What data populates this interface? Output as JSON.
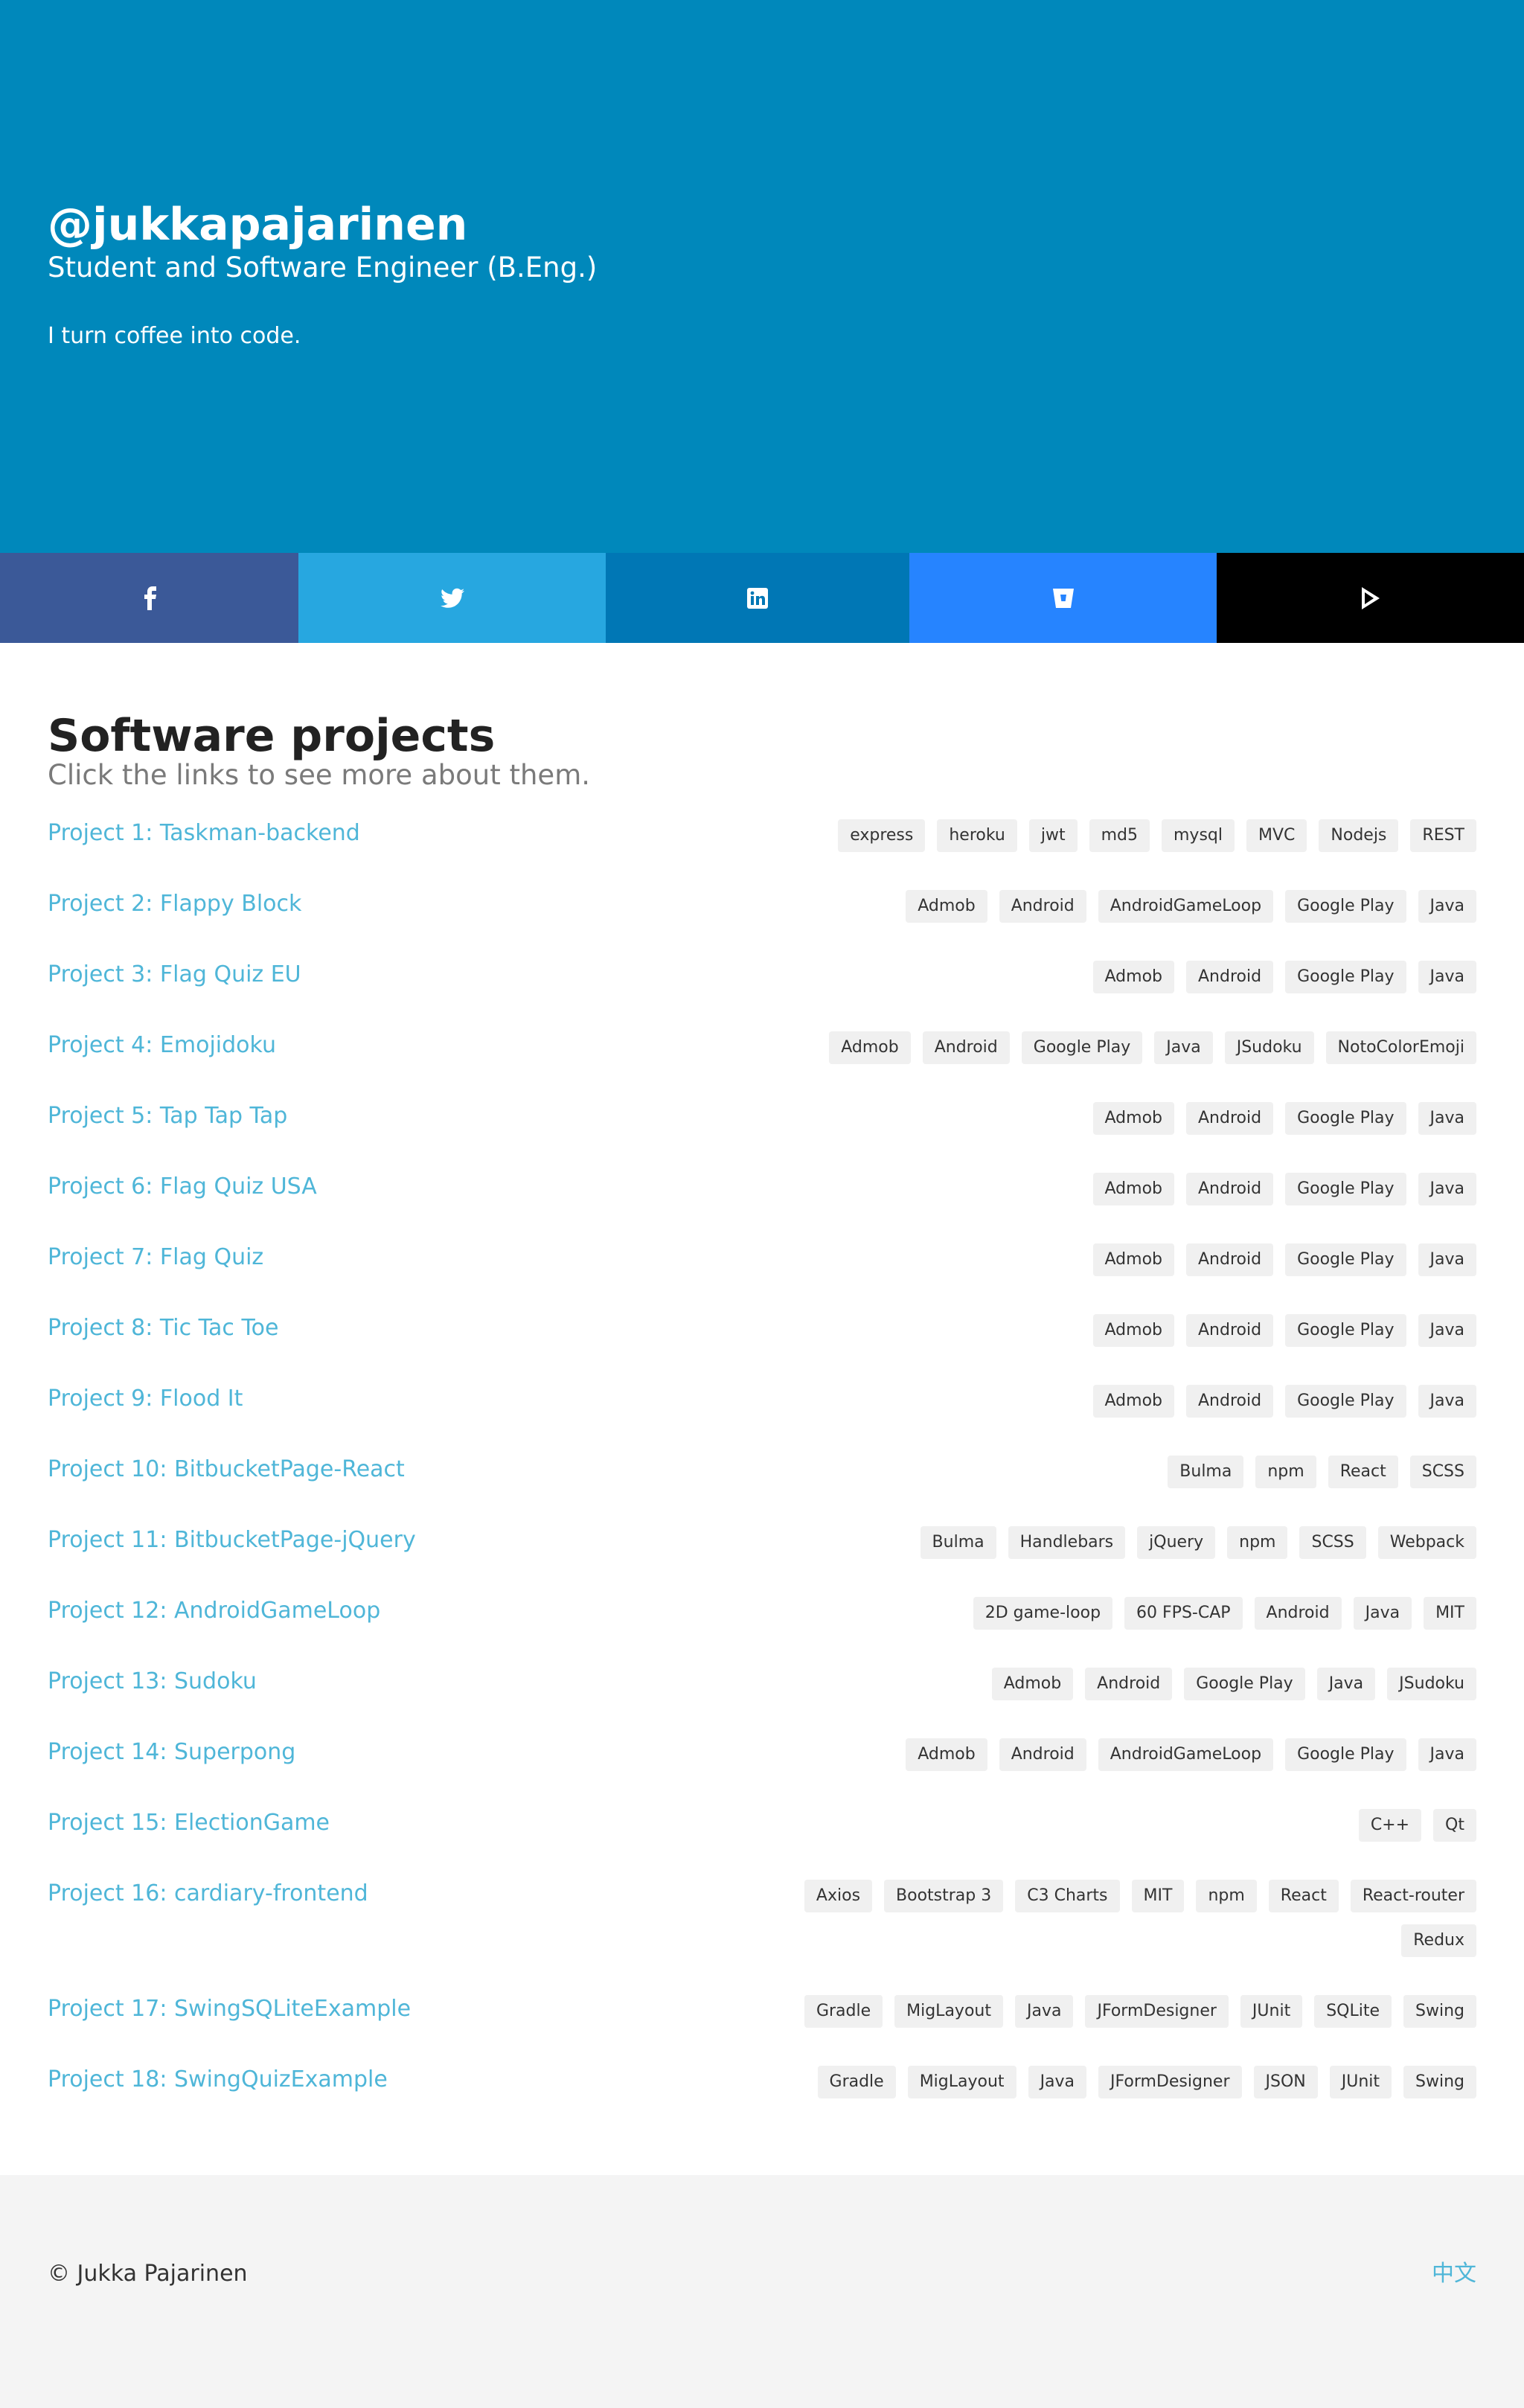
{
  "hero": {
    "title": "@jukkapajarinen",
    "subtitle": "Student and Software Engineer (B.Eng.)",
    "tagline": "I turn coffee into code."
  },
  "social": [
    {
      "name": "facebook",
      "icon": "facebook-icon",
      "color": "#3b5998"
    },
    {
      "name": "twitter",
      "icon": "twitter-icon",
      "color": "#27a7e0"
    },
    {
      "name": "linkedin",
      "icon": "linkedin-icon",
      "color": "#0077b5"
    },
    {
      "name": "bitbucket",
      "icon": "bitbucket-icon",
      "color": "#2684ff"
    },
    {
      "name": "google-play",
      "icon": "google-play-icon",
      "color": "#000000"
    }
  ],
  "projects_section": {
    "title": "Software projects",
    "subtitle": "Click the links to see more about them."
  },
  "projects": [
    {
      "label": "Project 1: Taskman-backend",
      "tags": [
        "express",
        "heroku",
        "jwt",
        "md5",
        "mysql",
        "MVC",
        "Nodejs",
        "REST"
      ]
    },
    {
      "label": "Project 2: Flappy Block",
      "tags": [
        "Admob",
        "Android",
        "AndroidGameLoop",
        "Google Play",
        "Java"
      ]
    },
    {
      "label": "Project 3: Flag Quiz EU",
      "tags": [
        "Admob",
        "Android",
        "Google Play",
        "Java"
      ]
    },
    {
      "label": "Project 4: Emojidoku",
      "tags": [
        "Admob",
        "Android",
        "Google Play",
        "Java",
        "JSudoku",
        "NotoColorEmoji"
      ]
    },
    {
      "label": "Project 5: Tap Tap Tap",
      "tags": [
        "Admob",
        "Android",
        "Google Play",
        "Java"
      ]
    },
    {
      "label": "Project 6: Flag Quiz USA",
      "tags": [
        "Admob",
        "Android",
        "Google Play",
        "Java"
      ]
    },
    {
      "label": "Project 7: Flag Quiz",
      "tags": [
        "Admob",
        "Android",
        "Google Play",
        "Java"
      ]
    },
    {
      "label": "Project 8: Tic Tac Toe",
      "tags": [
        "Admob",
        "Android",
        "Google Play",
        "Java"
      ]
    },
    {
      "label": "Project 9: Flood It",
      "tags": [
        "Admob",
        "Android",
        "Google Play",
        "Java"
      ]
    },
    {
      "label": "Project 10: BitbucketPage-React",
      "tags": [
        "Bulma",
        "npm",
        "React",
        "SCSS"
      ]
    },
    {
      "label": "Project 11: BitbucketPage-jQuery",
      "tags": [
        "Bulma",
        "Handlebars",
        "jQuery",
        "npm",
        "SCSS",
        "Webpack"
      ]
    },
    {
      "label": "Project 12: AndroidGameLoop",
      "tags": [
        "2D game-loop",
        "60 FPS-CAP",
        "Android",
        "Java",
        "MIT"
      ]
    },
    {
      "label": "Project 13: Sudoku",
      "tags": [
        "Admob",
        "Android",
        "Google Play",
        "Java",
        "JSudoku"
      ]
    },
    {
      "label": "Project 14: Superpong",
      "tags": [
        "Admob",
        "Android",
        "AndroidGameLoop",
        "Google Play",
        "Java"
      ]
    },
    {
      "label": "Project 15: ElectionGame",
      "tags": [
        "C++",
        "Qt"
      ]
    },
    {
      "label": "Project 16: cardiary-frontend",
      "tags": [
        "Axios",
        "Bootstrap 3",
        "C3 Charts",
        "MIT",
        "npm",
        "React",
        "React-router",
        "Redux"
      ]
    },
    {
      "label": "Project 17: SwingSQLiteExample",
      "tags": [
        "Gradle",
        "MigLayout",
        "Java",
        "JFormDesigner",
        "JUnit",
        "SQLite",
        "Swing"
      ]
    },
    {
      "label": "Project 18: SwingQuizExample",
      "tags": [
        "Gradle",
        "MigLayout",
        "Java",
        "JFormDesigner",
        "JSON",
        "JUnit",
        "Swing"
      ]
    }
  ],
  "footer": {
    "copyright": "© Jukka Pajarinen",
    "language_link": "中文"
  },
  "colors": {
    "hero_bg": "#0088bb",
    "link": "#4fb6d8",
    "footer_bg": "#f4f4f4",
    "tag_bg": "#f0f0f0"
  }
}
